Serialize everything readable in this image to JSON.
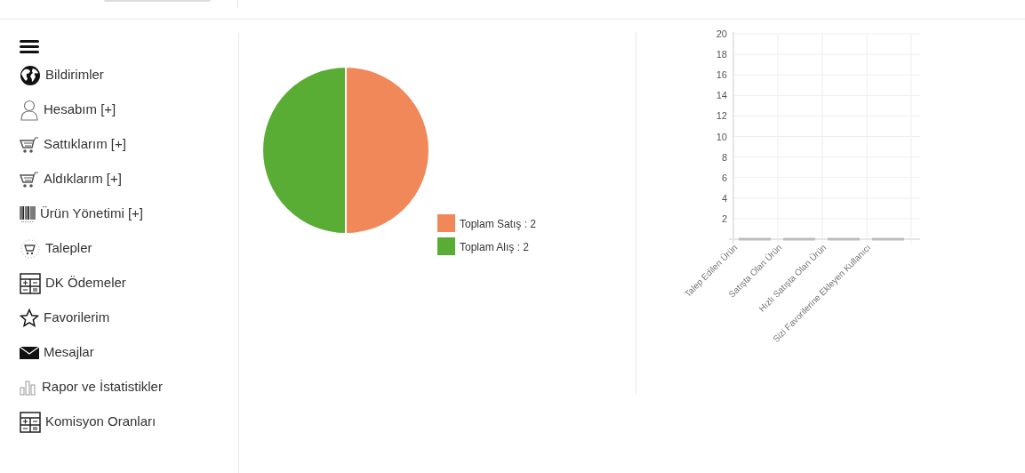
{
  "sidebar": {
    "items": [
      {
        "label": "Bildirimler"
      },
      {
        "label": "Hesabım [+]"
      },
      {
        "label": "Sattıklarım [+]"
      },
      {
        "label": "Aldıklarım [+]"
      },
      {
        "label": "Ürün Yönetimi [+]"
      },
      {
        "label": "Talepler"
      },
      {
        "label": "DK Ödemeler"
      },
      {
        "label": "Favorilerim"
      },
      {
        "label": "Mesajlar"
      },
      {
        "label": "Rapor ve İstatistikler"
      },
      {
        "label": "Komisyon Oranları"
      }
    ]
  },
  "pie_chart": {
    "chart_data": {
      "type": "pie",
      "categories": [
        "Toplam Satış : 2",
        "Toplam Alış : 2"
      ],
      "values": [
        2,
        2
      ],
      "colors": [
        "#f0885a",
        "#5aad34"
      ],
      "legend": "right"
    }
  },
  "bar_chart": {
    "chart_data": {
      "type": "bar",
      "categories": [
        "Talep Edilen Ürün",
        "Satışta Olan Ürün",
        "Hızlı Satışta Olan Ürün",
        "Sizi Favorilerine Ekleyen Kullanıcı"
      ],
      "series": [
        {
          "color": "#bdbdbd",
          "values": [
            0,
            0,
            0,
            0
          ]
        }
      ],
      "grid": true,
      "ylim": [
        0,
        20
      ],
      "yticks": [
        2,
        4,
        6,
        8,
        10,
        12,
        14,
        16,
        18,
        20
      ]
    }
  }
}
